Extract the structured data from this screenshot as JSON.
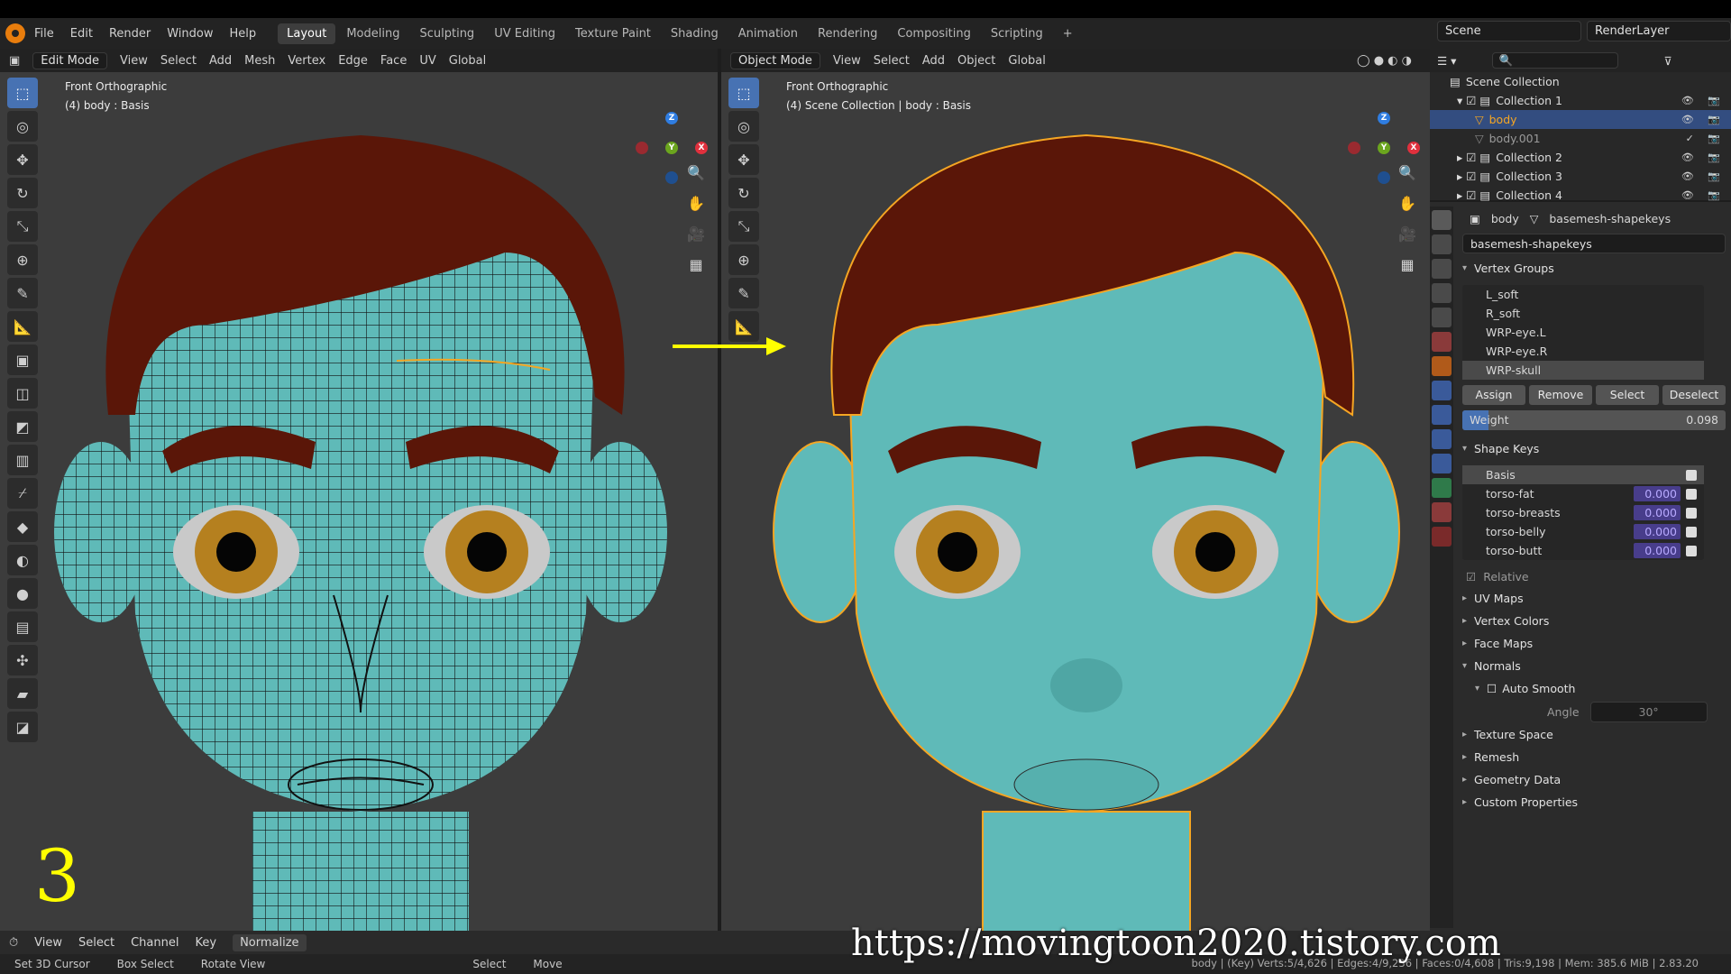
{
  "topbar": {
    "menu": [
      "File",
      "Edit",
      "Render",
      "Window",
      "Help"
    ],
    "workspaces": [
      "Layout",
      "Modeling",
      "Sculpting",
      "UV Editing",
      "Texture Paint",
      "Shading",
      "Animation",
      "Rendering",
      "Compositing",
      "Scripting"
    ],
    "active_workspace": "Layout",
    "scene": "Scene",
    "render_layer": "RenderLayer"
  },
  "left_viewport": {
    "mode": "Edit Mode",
    "menu": [
      "View",
      "Select",
      "Add",
      "Mesh",
      "Vertex",
      "Edge",
      "Face",
      "UV"
    ],
    "transform": "Global",
    "view_name": "Front Orthographic",
    "object_info": "(4) body : Basis"
  },
  "right_viewport": {
    "mode": "Object Mode",
    "menu": [
      "View",
      "Select",
      "Add",
      "Object"
    ],
    "transform": "Global",
    "view_name": "Front Orthographic",
    "object_info": "(4) Scene Collection | body : Basis"
  },
  "outliner": {
    "root": "Scene Collection",
    "rows": [
      {
        "label": "Collection 1",
        "selected": false
      },
      {
        "label": "body",
        "selected": true
      },
      {
        "label": "body.001",
        "selected": false
      },
      {
        "label": "Collection 2",
        "selected": false
      },
      {
        "label": "Collection 3",
        "selected": false
      },
      {
        "label": "Collection 4",
        "selected": false
      }
    ]
  },
  "properties": {
    "object": "body",
    "mesh": "basemesh-shapekeys",
    "mesh_field": "basemesh-shapekeys",
    "vertex_groups_title": "Vertex Groups",
    "vertex_groups": [
      "L_soft",
      "R_soft",
      "WRP-eye.L",
      "WRP-eye.R",
      "WRP-skull"
    ],
    "active_vertex_group": "WRP-skull",
    "buttons": {
      "assign": "Assign",
      "remove": "Remove",
      "select": "Select",
      "deselect": "Deselect"
    },
    "weight_label": "Weight",
    "weight_value": "0.098",
    "weight_fraction": 0.098,
    "shape_keys_title": "Shape Keys",
    "shape_keys": [
      {
        "name": "Basis",
        "value": ""
      },
      {
        "name": "torso-fat",
        "value": "0.000"
      },
      {
        "name": "torso-breasts",
        "value": "0.000"
      },
      {
        "name": "torso-belly",
        "value": "0.000"
      },
      {
        "name": "torso-butt",
        "value": "0.000"
      }
    ],
    "relative_label": "Relative",
    "sections": [
      "UV Maps",
      "Vertex Colors",
      "Face Maps",
      "Normals"
    ],
    "auto_smooth": "Auto Smooth",
    "angle_label": "Angle",
    "angle_value": "30°",
    "more_sections": [
      "Texture Space",
      "Remesh",
      "Geometry Data",
      "Custom Properties"
    ]
  },
  "dopesheet": {
    "menu": [
      "View",
      "Select",
      "Channel",
      "Key"
    ],
    "normalize": "Normalize"
  },
  "statusbar": {
    "items": [
      "Set 3D Cursor",
      "Box Select",
      "Rotate View",
      "Select",
      "Move"
    ],
    "stats": "body | (Key) Verts:5/4,626 | Edges:4/9,236 | Faces:0/4,608 | Tris:9,198 | Mem: 385.6 MiB | 2.83.20"
  },
  "overlay": {
    "step_number": "3",
    "watermark": "https://movingtoon2020.tistory.com"
  },
  "colors": {
    "skin": "#5fbab8",
    "hair": "#5a1608",
    "iris": "#b5801f",
    "selection_outline": "#f5a623",
    "accent": "#4772b3"
  }
}
